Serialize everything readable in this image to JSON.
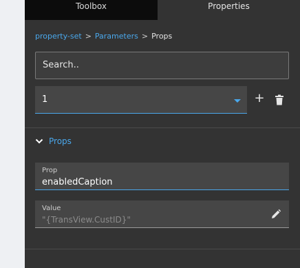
{
  "tabs": [
    {
      "label": "Toolbox",
      "active": false
    },
    {
      "label": "Properties",
      "active": true
    }
  ],
  "breadcrumb": {
    "items": [
      "property-set",
      "Parameters",
      "Props"
    ],
    "separator": ">"
  },
  "search": {
    "placeholder": "Search.."
  },
  "selector": {
    "value": "1"
  },
  "actions": {
    "add_symbol": "+",
    "add_icon": "plus-icon",
    "delete_icon": "trash-icon"
  },
  "section": {
    "title": "Props",
    "expanded": true,
    "icon": "chevron-down-icon"
  },
  "fields": {
    "prop": {
      "label": "Prop",
      "value": "enabledCaption"
    },
    "value": {
      "label": "Value",
      "placeholder": "\"{TransView.CustID}\"",
      "edit_icon": "pencil-icon"
    }
  },
  "colors": {
    "panel": "#333333",
    "tab_inactive": "#0c0c0c",
    "accent": "#4aa8ec",
    "field_bg": "#464646",
    "outer_bg": "#eef0f3"
  }
}
